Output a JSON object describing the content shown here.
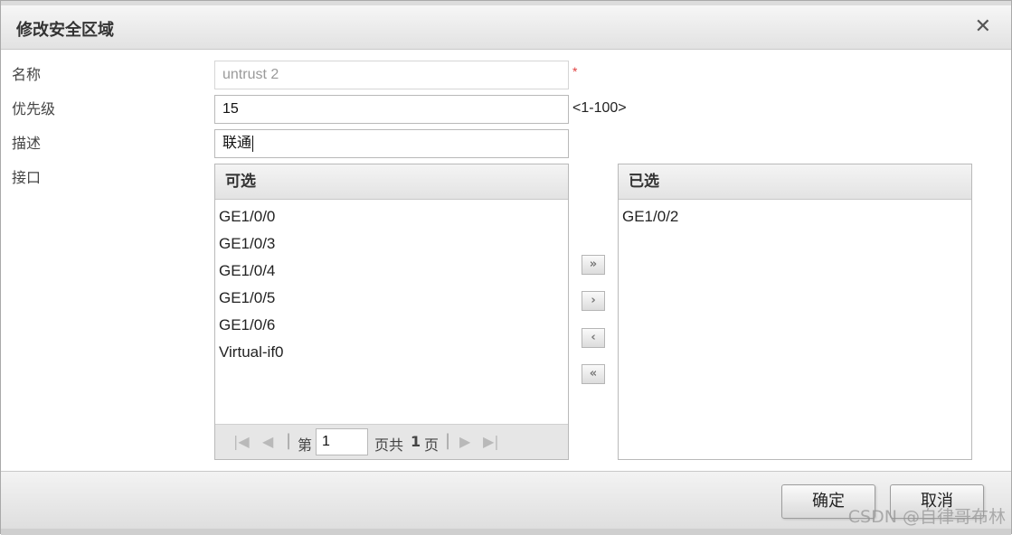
{
  "dialog": {
    "title": "修改安全区域",
    "close_glyph": "✕"
  },
  "form": {
    "name_label": "名称",
    "name_value": "untrust 2",
    "required_mark": "*",
    "priority_label": "优先级",
    "priority_value": "15",
    "priority_hint": "<1-100>",
    "desc_label": "描述",
    "desc_value": "联通",
    "interface_label": "接口"
  },
  "available": {
    "header": "可选",
    "items": [
      "GE1/0/0",
      "GE1/0/3",
      "GE1/0/4",
      "GE1/0/5",
      "GE1/0/6",
      "Virtual-if0"
    ]
  },
  "pager": {
    "prefix": "第",
    "page": "1",
    "middle": "页共",
    "total": "1",
    "suffix": "页"
  },
  "selected": {
    "header": "已选",
    "items": [
      "GE1/0/2"
    ]
  },
  "move_buttons": {
    "add_all": "»",
    "add": "›",
    "remove": "‹",
    "remove_all": "«"
  },
  "footer": {
    "ok_label": "确定",
    "cancel_label": "取消"
  },
  "watermark": "CSDN @自律哥布林",
  "icons": {
    "first_page": "first-page-icon",
    "prev_page": "prev-page-icon",
    "next_page": "next-page-icon",
    "last_page": "last-page-icon"
  }
}
